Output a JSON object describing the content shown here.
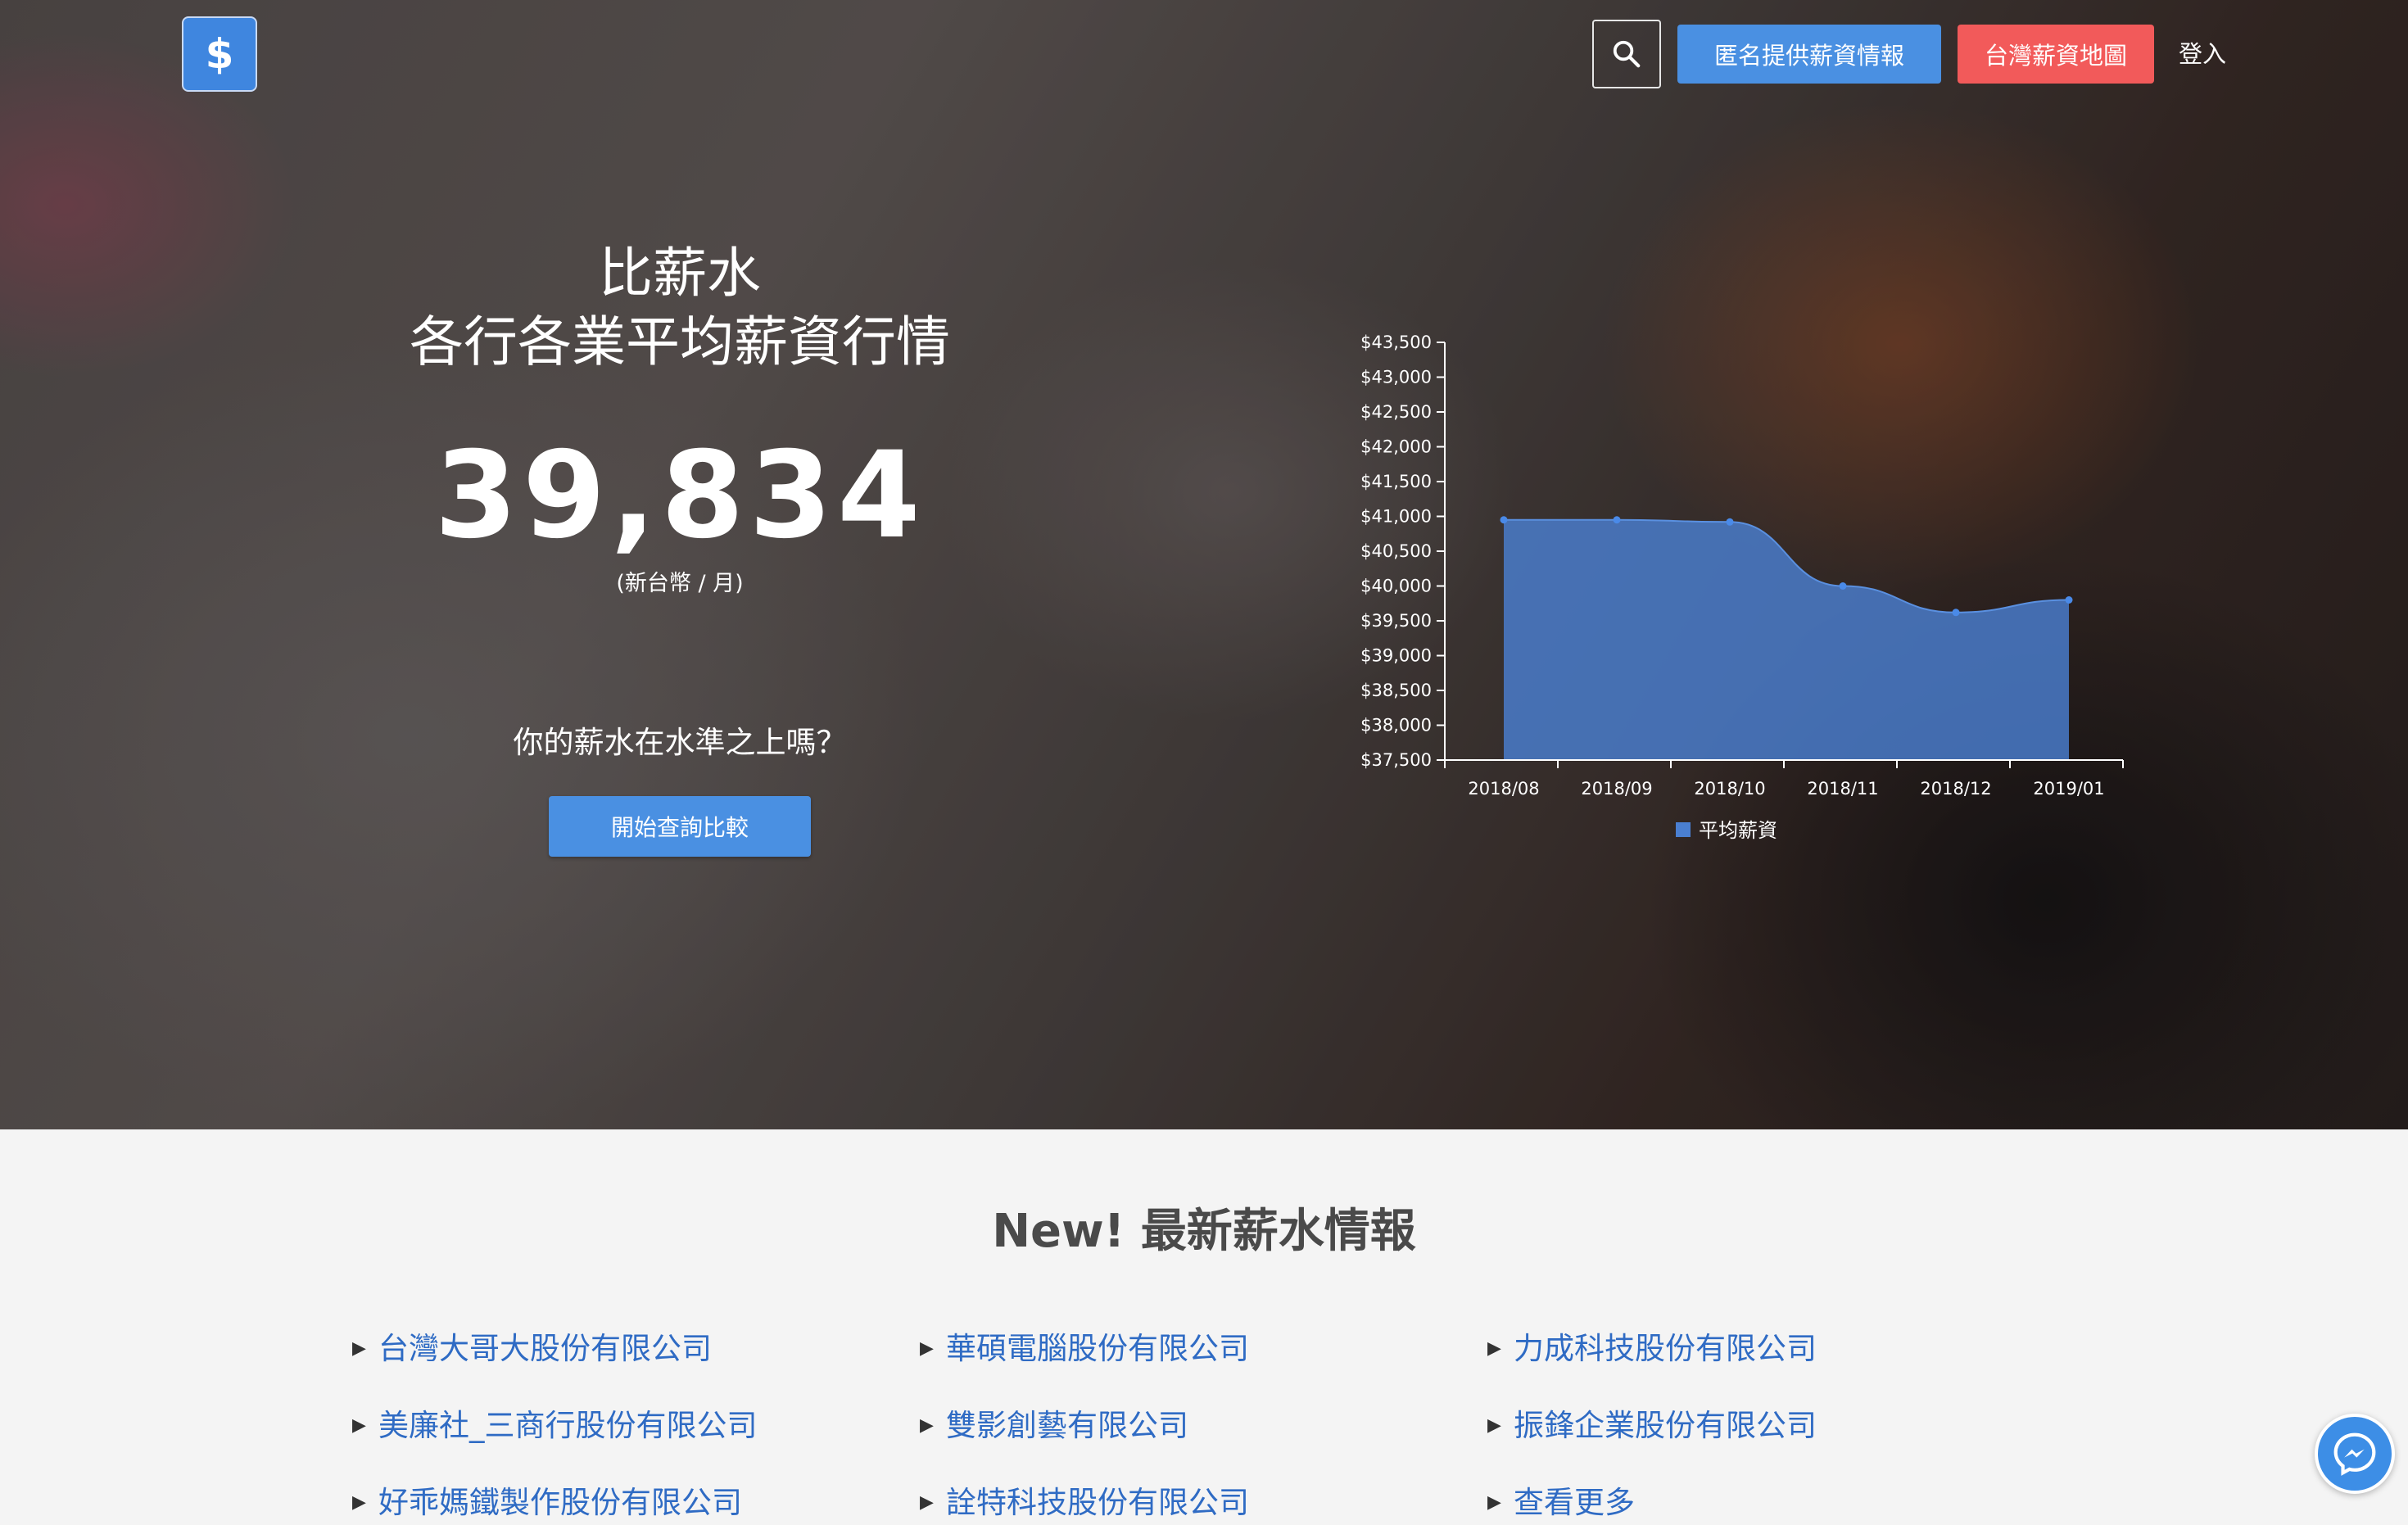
{
  "header": {
    "logo_symbol": "$",
    "anonymous_button": "匿名提供薪資情報",
    "map_button": "台灣薪資地圖",
    "login": "登入"
  },
  "hero": {
    "title_line1": "比薪水",
    "title_line2": "各行各業平均薪資行情",
    "average_salary": "39,834",
    "unit": "(新台幣 / 月)",
    "question": "你的薪水在水準之上嗎？",
    "cta": "開始查詢比較"
  },
  "chart_data": {
    "type": "area",
    "x": [
      "2018/08",
      "2018/09",
      "2018/10",
      "2018/11",
      "2018/12",
      "2019/01"
    ],
    "series": [
      {
        "name": "平均薪資",
        "values": [
          40950,
          40950,
          40920,
          40000,
          39620,
          39800
        ],
        "color": "#4a7fd1"
      }
    ],
    "ylim": [
      37500,
      43500
    ],
    "yticks": [
      43500,
      43000,
      42500,
      42000,
      41500,
      41000,
      40500,
      40000,
      39500,
      39000,
      38500,
      38000,
      37500
    ],
    "ytick_labels": [
      "$43,500",
      "$43,000",
      "$42,500",
      "$42,000",
      "$41,500",
      "$41,000",
      "$40,500",
      "$40,000",
      "$39,500",
      "$39,000",
      "$38,500",
      "$38,000",
      "$37,500"
    ],
    "legend_position": "bottom"
  },
  "latest": {
    "title": "New! 最新薪水情報",
    "companies": [
      "台灣大哥大股份有限公司",
      "華碩電腦股份有限公司",
      "力成科技股份有限公司",
      "美廉社_三商行股份有限公司",
      "雙影創藝有限公司",
      "振鋒企業股份有限公司",
      "好乖媽鐵製作股份有限公司",
      "詮特科技股份有限公司",
      "查看更多"
    ]
  },
  "colors": {
    "primary": "#4a90e2",
    "danger": "#f25a5a",
    "link": "#2f6bc4"
  }
}
